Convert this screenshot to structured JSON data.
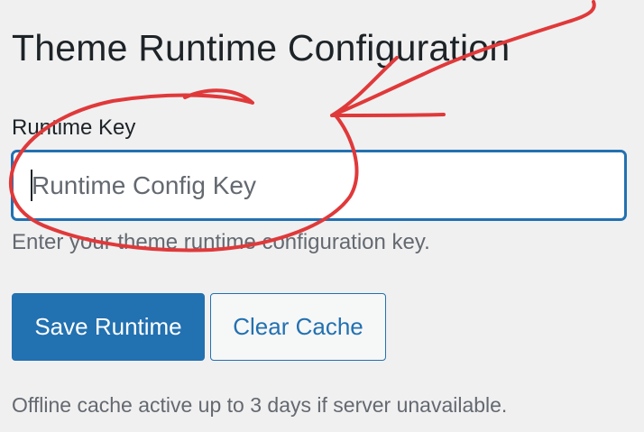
{
  "page": {
    "title": "Theme Runtime Configuration"
  },
  "form": {
    "field_label": "Runtime Key",
    "input_value": "",
    "input_placeholder": "Runtime Config Key",
    "help_text": "Enter your theme runtime configuration key."
  },
  "actions": {
    "save_label": "Save Runtime",
    "clear_label": "Clear Cache"
  },
  "footer": {
    "note": "Offline cache active up to 3 days if server unavailable."
  },
  "colors": {
    "background": "#f0f0f1",
    "accent": "#2271b1",
    "annotation": "#e0393a",
    "muted_text": "#646970"
  },
  "annotations": {
    "icons": [
      "circle-annotation-icon",
      "arrow-annotation-icon"
    ]
  }
}
